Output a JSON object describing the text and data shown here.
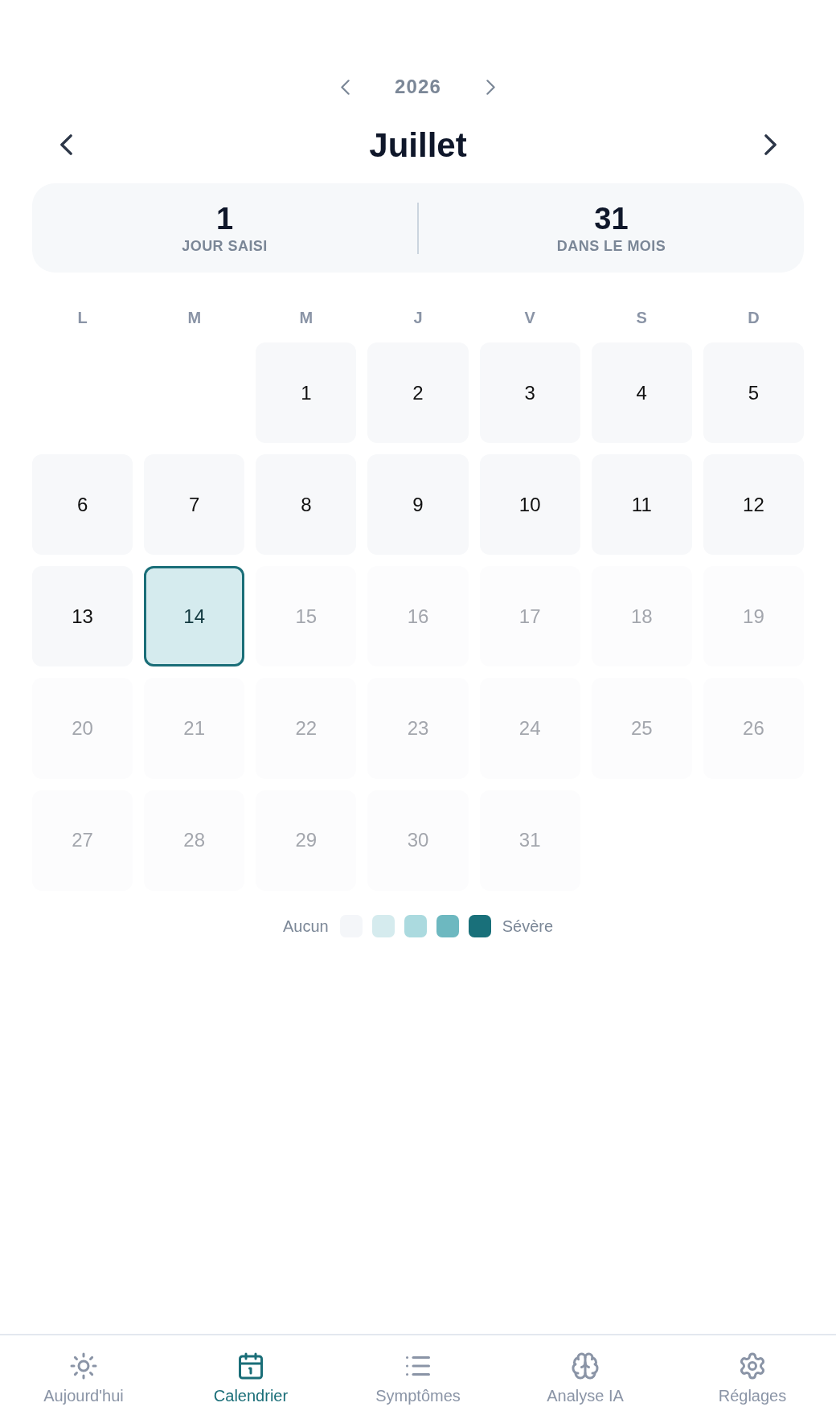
{
  "year_nav": {
    "year": "2026"
  },
  "month_nav": {
    "month": "Juillet"
  },
  "stats": [
    {
      "value": "1",
      "label": "JOUR SAISI"
    },
    {
      "value": "31",
      "label": "DANS LE MOIS"
    }
  ],
  "calendar": {
    "weekdays": [
      "L",
      "M",
      "M",
      "J",
      "V",
      "S",
      "D"
    ],
    "days": [
      {
        "kind": "blank"
      },
      {
        "kind": "blank"
      },
      {
        "label": "1",
        "kind": "past",
        "selected": false
      },
      {
        "label": "2",
        "kind": "past",
        "selected": false
      },
      {
        "label": "3",
        "kind": "past",
        "selected": false
      },
      {
        "label": "4",
        "kind": "past",
        "selected": false
      },
      {
        "label": "5",
        "kind": "past",
        "selected": false
      },
      {
        "label": "6",
        "kind": "past",
        "selected": false
      },
      {
        "label": "7",
        "kind": "past",
        "selected": false
      },
      {
        "label": "8",
        "kind": "past",
        "selected": false
      },
      {
        "label": "9",
        "kind": "past",
        "selected": false
      },
      {
        "label": "10",
        "kind": "past",
        "selected": false
      },
      {
        "label": "11",
        "kind": "past",
        "selected": false
      },
      {
        "label": "12",
        "kind": "past",
        "selected": false
      },
      {
        "label": "13",
        "kind": "past",
        "selected": false
      },
      {
        "label": "14",
        "kind": "past",
        "selected": true,
        "color": "#d5ebee"
      },
      {
        "label": "15",
        "kind": "future",
        "selected": false
      },
      {
        "label": "16",
        "kind": "future",
        "selected": false
      },
      {
        "label": "17",
        "kind": "future",
        "selected": false
      },
      {
        "label": "18",
        "kind": "future",
        "selected": false
      },
      {
        "label": "19",
        "kind": "future",
        "selected": false
      },
      {
        "label": "20",
        "kind": "future",
        "selected": false
      },
      {
        "label": "21",
        "kind": "future",
        "selected": false
      },
      {
        "label": "22",
        "kind": "future",
        "selected": false
      },
      {
        "label": "23",
        "kind": "future",
        "selected": false
      },
      {
        "label": "24",
        "kind": "future",
        "selected": false
      },
      {
        "label": "25",
        "kind": "future",
        "selected": false
      },
      {
        "label": "26",
        "kind": "future",
        "selected": false
      },
      {
        "label": "27",
        "kind": "future",
        "selected": false
      },
      {
        "label": "28",
        "kind": "future",
        "selected": false
      },
      {
        "label": "29",
        "kind": "future",
        "selected": false
      },
      {
        "label": "30",
        "kind": "future",
        "selected": false
      },
      {
        "label": "31",
        "kind": "future",
        "selected": false
      }
    ]
  },
  "legend": {
    "low_label": "Aucun",
    "high_label": "Sévère",
    "swatches": [
      {
        "color": "#f4f6f9"
      },
      {
        "color": "#d5ebee"
      },
      {
        "color": "#abdadf"
      },
      {
        "color": "#6db8c0"
      },
      {
        "color": "#19707a"
      }
    ]
  },
  "nav": {
    "items": [
      {
        "label": "Aujourd'hui",
        "selected": false
      },
      {
        "label": "Calendrier",
        "selected": true
      },
      {
        "label": "Symptômes",
        "selected": false
      },
      {
        "label": "Analyse IA",
        "selected": false
      },
      {
        "label": "Réglages",
        "selected": false
      }
    ]
  }
}
